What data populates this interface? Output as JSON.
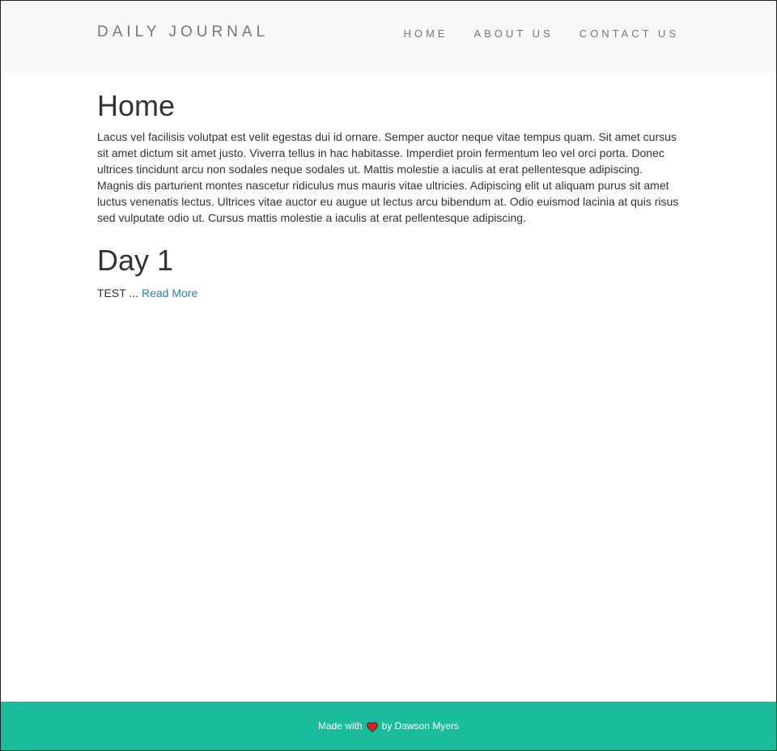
{
  "navbar": {
    "brand": "DAILY JOURNAL",
    "links": [
      "HOME",
      "ABOUT US",
      "CONTACT US"
    ]
  },
  "main": {
    "title": "Home",
    "intro": "Lacus vel facilisis volutpat est velit egestas dui id ornare. Semper auctor neque vitae tempus quam. Sit amet cursus sit amet dictum sit amet justo. Viverra tellus in hac habitasse. Imperdiet proin fermentum leo vel orci porta. Donec ultrices tincidunt arcu non sodales neque sodales ut. Mattis molestie a iaculis at erat pellentesque adipiscing. Magnis dis parturient montes nascetur ridiculus mus mauris vitae ultricies. Adipiscing elit ut aliquam purus sit amet luctus venenatis lectus. Ultrices vitae auctor eu augue ut lectus arcu bibendum at. Odio euismod lacinia at quis risus sed vulputate odio ut. Cursus mattis molestie a iaculis at erat pellentesque adipiscing.",
    "posts": [
      {
        "title": "Day 1",
        "excerpt": "TEST ...",
        "read_more": "Read More"
      }
    ]
  },
  "footer": {
    "made_with": "Made with",
    "icon": "heart-icon",
    "by": "by Dawson Myers"
  },
  "colors": {
    "navbar_bg": "#f8f8f8",
    "footer_bg": "#1abc9c",
    "link": "#337ab7",
    "heart": "#e0201b"
  }
}
